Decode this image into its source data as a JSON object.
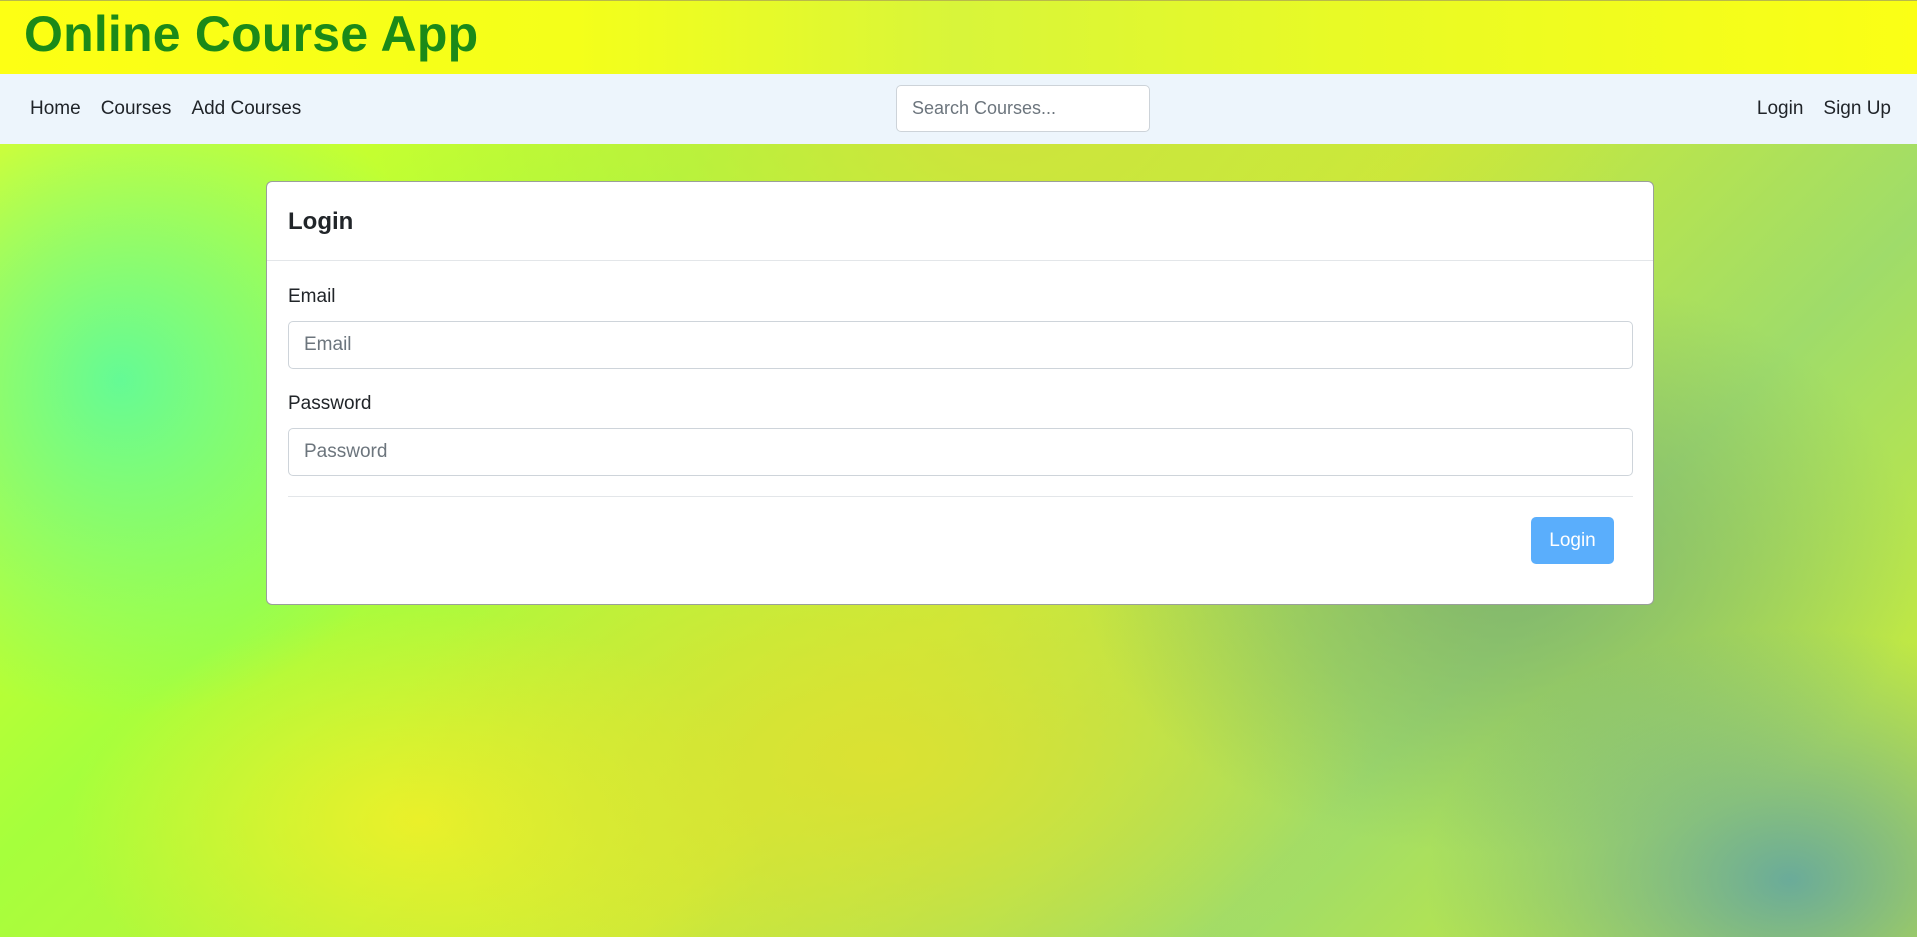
{
  "app": {
    "title": "Online Course App"
  },
  "navbar": {
    "left_links": [
      {
        "label": "Home"
      },
      {
        "label": "Courses"
      },
      {
        "label": "Add Courses"
      }
    ],
    "search": {
      "placeholder": "Search Courses...",
      "value": ""
    },
    "right_links": [
      {
        "label": "Login"
      },
      {
        "label": "Sign Up"
      }
    ]
  },
  "login_card": {
    "title": "Login",
    "email": {
      "label": "Email",
      "placeholder": "Email",
      "value": ""
    },
    "password": {
      "label": "Password",
      "placeholder": "Password",
      "value": ""
    },
    "submit_label": "Login"
  },
  "colors": {
    "title_green": "#1b8a18",
    "banner_yellow": "#fdff14",
    "navbar_bg": "#edf5fc",
    "button_blue": "#5aaefc"
  }
}
